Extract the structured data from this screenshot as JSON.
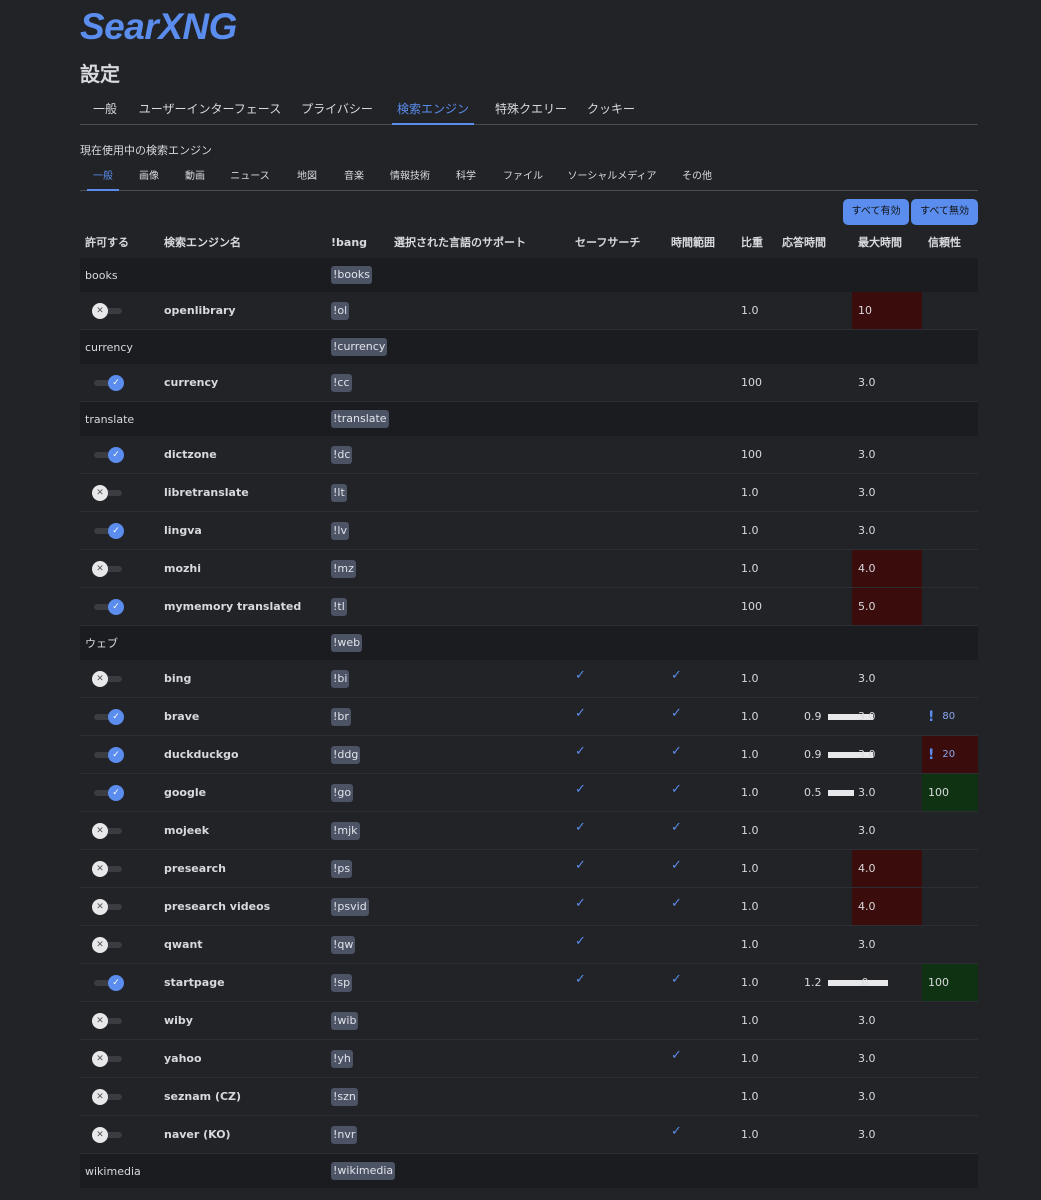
{
  "logo": "SearXNG",
  "page_title": "設定",
  "main_tabs": [
    "一般",
    "ユーザーインターフェース",
    "プライバシー",
    "検索エンジン",
    "特殊クエリー",
    "クッキー"
  ],
  "section_label": "現在使用中の検索エンジン",
  "sub_tabs": [
    "一般",
    "画像",
    "動画",
    "ニュース",
    "地図",
    "音楽",
    "情報技術",
    "科学",
    "ファイル",
    "ソーシャルメディア",
    "その他"
  ],
  "buttons": {
    "enable_all": "すべて有効",
    "disable_all": "すべて無効"
  },
  "columns": [
    "許可する",
    "検索エンジン名",
    "!bang",
    "選択された言語のサポート",
    "セーフサーチ",
    "時間範囲",
    "比重",
    "応答時間",
    "最大時間",
    "信頼性"
  ],
  "toggle_icons": {
    "on": "✓",
    "off": "✕"
  },
  "check_icon": "✓",
  "exclamation_icon": "!",
  "colors": {
    "accent": "#5a8dee",
    "background": "#222326",
    "category_row": "#1b1c1f",
    "warning_bg": "#3a0c0c",
    "ok_bg": "#0f3312"
  },
  "rows": [
    {
      "type": "cat",
      "name": "books",
      "bang": "!books"
    },
    {
      "type": "eng",
      "on": false,
      "name": "openlibrary",
      "bang": "!ol",
      "safe": false,
      "time": false,
      "weight": "1.0",
      "resp": "",
      "resp_frac": 0,
      "maxtime": "10",
      "maxtime_warn": true,
      "rel": "",
      "rel_style": ""
    },
    {
      "type": "cat",
      "name": "currency",
      "bang": "!currency"
    },
    {
      "type": "eng",
      "on": true,
      "name": "currency",
      "bang": "!cc",
      "safe": false,
      "time": false,
      "weight": "100",
      "resp": "",
      "resp_frac": 0,
      "maxtime": "3.0",
      "maxtime_warn": false,
      "rel": "",
      "rel_style": ""
    },
    {
      "type": "cat",
      "name": "translate",
      "bang": "!translate"
    },
    {
      "type": "eng",
      "on": true,
      "name": "dictzone",
      "bang": "!dc",
      "safe": false,
      "time": false,
      "weight": "100",
      "resp": "",
      "resp_frac": 0,
      "maxtime": "3.0",
      "maxtime_warn": false,
      "rel": "",
      "rel_style": ""
    },
    {
      "type": "eng",
      "on": false,
      "name": "libretranslate",
      "bang": "!lt",
      "safe": false,
      "time": false,
      "weight": "1.0",
      "resp": "",
      "resp_frac": 0,
      "maxtime": "3.0",
      "maxtime_warn": false,
      "rel": "",
      "rel_style": ""
    },
    {
      "type": "eng",
      "on": true,
      "name": "lingva",
      "bang": "!lv",
      "safe": false,
      "time": false,
      "weight": "1.0",
      "resp": "",
      "resp_frac": 0,
      "maxtime": "3.0",
      "maxtime_warn": false,
      "rel": "",
      "rel_style": ""
    },
    {
      "type": "eng",
      "on": false,
      "name": "mozhi",
      "bang": "!mz",
      "safe": false,
      "time": false,
      "weight": "1.0",
      "resp": "",
      "resp_frac": 0,
      "maxtime": "4.0",
      "maxtime_warn": true,
      "rel": "",
      "rel_style": ""
    },
    {
      "type": "eng",
      "on": true,
      "name": "mymemory translated",
      "bang": "!tl",
      "safe": false,
      "time": false,
      "weight": "100",
      "resp": "",
      "resp_frac": 0,
      "maxtime": "5.0",
      "maxtime_warn": true,
      "rel": "",
      "rel_style": ""
    },
    {
      "type": "cat",
      "name": "ウェブ",
      "bang": "!web"
    },
    {
      "type": "eng",
      "on": false,
      "name": "bing",
      "bang": "!bi",
      "safe": true,
      "time": true,
      "weight": "1.0",
      "resp": "",
      "resp_frac": 0,
      "maxtime": "3.0",
      "maxtime_warn": false,
      "rel": "",
      "rel_style": ""
    },
    {
      "type": "eng",
      "on": true,
      "name": "brave",
      "bang": "!br",
      "safe": true,
      "time": true,
      "weight": "1.0",
      "resp": "0.9",
      "resp_frac": 0.3,
      "maxtime": "3.0",
      "maxtime_warn": false,
      "rel": "80",
      "rel_style": "excl"
    },
    {
      "type": "eng",
      "on": true,
      "name": "duckduckgo",
      "bang": "!ddg",
      "safe": true,
      "time": true,
      "weight": "1.0",
      "resp": "0.9",
      "resp_frac": 0.3,
      "maxtime": "3.0",
      "maxtime_warn": false,
      "rel": "20",
      "rel_style": "excl-red"
    },
    {
      "type": "eng",
      "on": true,
      "name": "google",
      "bang": "!go",
      "safe": true,
      "time": true,
      "weight": "1.0",
      "resp": "0.5",
      "resp_frac": 0.17,
      "maxtime": "3.0",
      "maxtime_warn": false,
      "rel": "100",
      "rel_style": "green"
    },
    {
      "type": "eng",
      "on": false,
      "name": "mojeek",
      "bang": "!mjk",
      "safe": true,
      "time": true,
      "weight": "1.0",
      "resp": "",
      "resp_frac": 0,
      "maxtime": "3.0",
      "maxtime_warn": false,
      "rel": "",
      "rel_style": ""
    },
    {
      "type": "eng",
      "on": false,
      "name": "presearch",
      "bang": "!ps",
      "safe": true,
      "time": true,
      "weight": "1.0",
      "resp": "",
      "resp_frac": 0,
      "maxtime": "4.0",
      "maxtime_warn": true,
      "rel": "",
      "rel_style": ""
    },
    {
      "type": "eng",
      "on": false,
      "name": "presearch videos",
      "bang": "!psvid",
      "safe": true,
      "time": true,
      "weight": "1.0",
      "resp": "",
      "resp_frac": 0,
      "maxtime": "4.0",
      "maxtime_warn": true,
      "rel": "",
      "rel_style": ""
    },
    {
      "type": "eng",
      "on": false,
      "name": "qwant",
      "bang": "!qw",
      "safe": true,
      "time": false,
      "weight": "1.0",
      "resp": "",
      "resp_frac": 0,
      "maxtime": "3.0",
      "maxtime_warn": false,
      "rel": "",
      "rel_style": ""
    },
    {
      "type": "eng",
      "on": true,
      "name": "startpage",
      "bang": "!sp",
      "safe": true,
      "time": true,
      "weight": "1.0",
      "resp": "1.2",
      "resp_frac": 0.4,
      "maxtime": ".0",
      "maxtime_warn": false,
      "rel": "100",
      "rel_style": "green"
    },
    {
      "type": "eng",
      "on": false,
      "name": "wiby",
      "bang": "!wib",
      "safe": false,
      "time": false,
      "weight": "1.0",
      "resp": "",
      "resp_frac": 0,
      "maxtime": "3.0",
      "maxtime_warn": false,
      "rel": "",
      "rel_style": ""
    },
    {
      "type": "eng",
      "on": false,
      "name": "yahoo",
      "bang": "!yh",
      "safe": false,
      "time": true,
      "weight": "1.0",
      "resp": "",
      "resp_frac": 0,
      "maxtime": "3.0",
      "maxtime_warn": false,
      "rel": "",
      "rel_style": ""
    },
    {
      "type": "eng",
      "on": false,
      "name": "seznam (CZ)",
      "bang": "!szn",
      "safe": false,
      "time": false,
      "weight": "1.0",
      "resp": "",
      "resp_frac": 0,
      "maxtime": "3.0",
      "maxtime_warn": false,
      "rel": "",
      "rel_style": ""
    },
    {
      "type": "eng",
      "on": false,
      "name": "naver (KO)",
      "bang": "!nvr",
      "safe": false,
      "time": true,
      "weight": "1.0",
      "resp": "",
      "resp_frac": 0,
      "maxtime": "3.0",
      "maxtime_warn": false,
      "rel": "",
      "rel_style": ""
    },
    {
      "type": "cat",
      "name": "wikimedia",
      "bang": "!wikimedia"
    }
  ]
}
